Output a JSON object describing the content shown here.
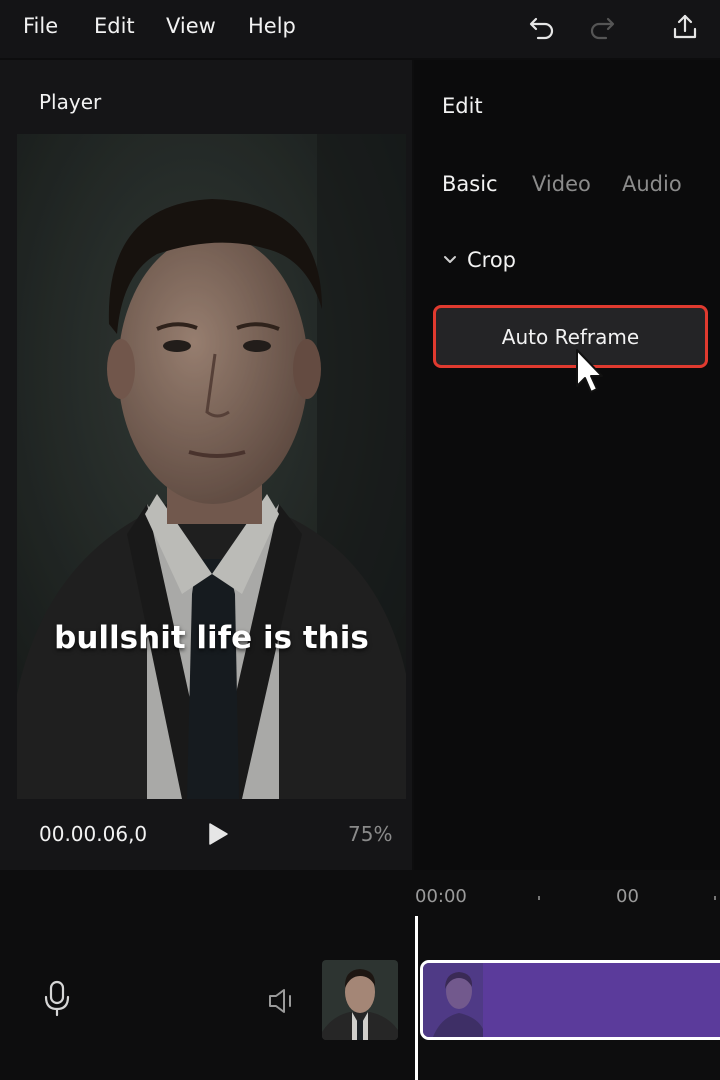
{
  "menu": {
    "file": "File",
    "edit": "Edit",
    "view": "View",
    "help": "Help"
  },
  "toolbar_icons": [
    "undo-icon",
    "redo-icon",
    "export-icon"
  ],
  "player": {
    "title": "Player",
    "subtitle": "bullshit life is this",
    "timecode": "00.00.06,0",
    "zoom": "75%"
  },
  "edit_panel": {
    "title": "Edit",
    "tabs": [
      {
        "label": "Basic",
        "active": true
      },
      {
        "label": "Video",
        "active": false
      },
      {
        "label": "Audio",
        "active": false
      }
    ],
    "section": "Crop",
    "auto_reframe_label": "Auto Reframe"
  },
  "timeline": {
    "ruler_start": "00:00",
    "ruler_next": "00"
  },
  "colors": {
    "highlight": "#e03a2f",
    "clip": "#5b3b9b",
    "background": "#0d0d0e"
  }
}
